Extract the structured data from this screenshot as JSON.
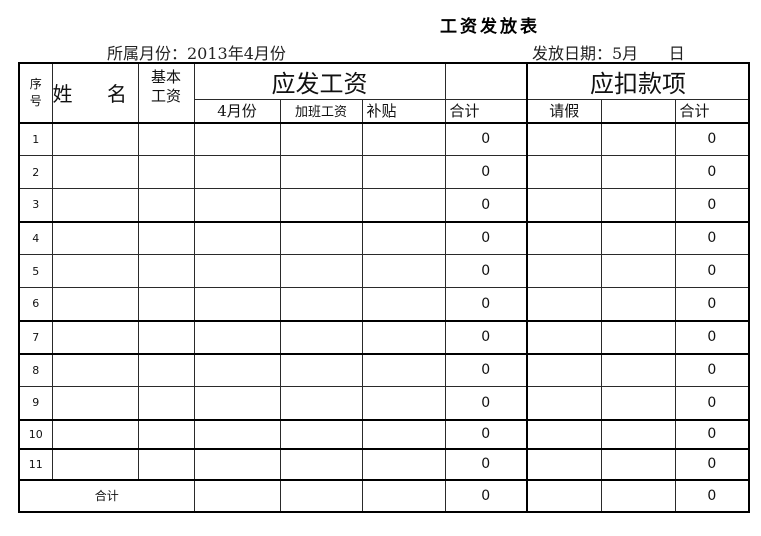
{
  "title": "工资发放表",
  "period_label": "所属月份：2013年4月份",
  "pay_date_label": "发放日期：5月      日",
  "headers": {
    "seq": "序\n号",
    "seq_top": "序",
    "seq_bottom": "号",
    "name": "姓 名",
    "base_top": "基本",
    "base_bottom": "工资",
    "payable_group": "应发工资",
    "deduct_group": "应扣款项",
    "april": "4月份",
    "overtime": "加班工资",
    "subsidy": "补贴",
    "payable_total": "合计",
    "leave": "请假",
    "deduct_blank": "",
    "deduct_total": "合计"
  },
  "rows": [
    {
      "seq": "1",
      "payable_total": "0",
      "deduct_total": "0"
    },
    {
      "seq": "2",
      "payable_total": "0",
      "deduct_total": "0"
    },
    {
      "seq": "3",
      "payable_total": "0",
      "deduct_total": "0"
    },
    {
      "seq": "4",
      "payable_total": "0",
      "deduct_total": "0"
    },
    {
      "seq": "5",
      "payable_total": "0",
      "deduct_total": "0"
    },
    {
      "seq": "6",
      "payable_total": "0",
      "deduct_total": "0"
    },
    {
      "seq": "7",
      "payable_total": "0",
      "deduct_total": "0"
    },
    {
      "seq": "8",
      "payable_total": "0",
      "deduct_total": "0"
    },
    {
      "seq": "9",
      "payable_total": "0",
      "deduct_total": "0"
    },
    {
      "seq": "10",
      "payable_total": "0",
      "deduct_total": "0"
    },
    {
      "seq": "11",
      "payable_total": "0",
      "deduct_total": "0"
    }
  ],
  "summary": {
    "label": "合计",
    "payable_total": "0",
    "deduct_total": "0"
  }
}
